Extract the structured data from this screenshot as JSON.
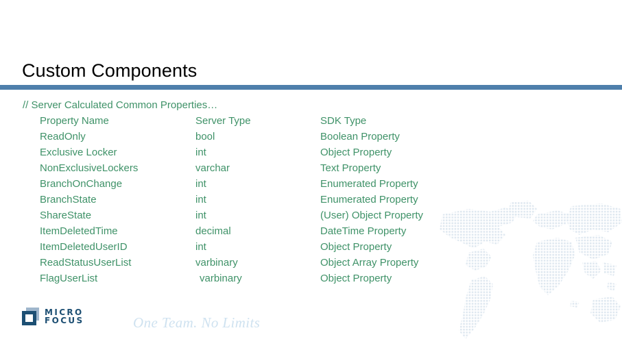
{
  "slide": {
    "title": "Custom Components",
    "accent_color": "#4e7fab",
    "body_text_color": "#3f9268",
    "title_color": "#000000"
  },
  "body": {
    "comment": "// Server Calculated Common Properties…",
    "columns": {
      "name": "Property Name",
      "server_type": "Server Type",
      "sdk_type": "SDK Type"
    },
    "rows": [
      {
        "name": "Property Name",
        "server_type": "Server Type",
        "sdk_type": "SDK Type",
        "indent_server": false
      },
      {
        "name": "ReadOnly",
        "server_type": "bool",
        "sdk_type": "Boolean Property",
        "indent_server": false
      },
      {
        "name": "Exclusive Locker",
        "server_type": "int",
        "sdk_type": "Object Property",
        "indent_server": false
      },
      {
        "name": "NonExclusiveLockers",
        "server_type": "varchar",
        "sdk_type": "Text Property",
        "indent_server": false
      },
      {
        "name": "BranchOnChange",
        "server_type": "int",
        "sdk_type": "Enumerated Property",
        "indent_server": false
      },
      {
        "name": "BranchState",
        "server_type": "int",
        "sdk_type": "Enumerated Property",
        "indent_server": false
      },
      {
        "name": "ShareState",
        "server_type": "int",
        "sdk_type": "(User) Object Property",
        "indent_server": false
      },
      {
        "name": "ItemDeletedTime",
        "server_type": "decimal",
        "sdk_type": "DateTime Property",
        "indent_server": false
      },
      {
        "name": "ItemDeletedUserID",
        "server_type": "int",
        "sdk_type": "Object Property",
        "indent_server": false
      },
      {
        "name": "ReadStatusUserList",
        "server_type": "varbinary",
        "sdk_type": "Object Array Property",
        "indent_server": false
      },
      {
        "name": "FlagUserList",
        "server_type": "varbinary",
        "sdk_type": "Object Property",
        "indent_server": true
      }
    ]
  },
  "footer": {
    "logo_line1": "MICRO",
    "logo_line2": "FOCUS",
    "logo_color": "#1d4f73",
    "tagline": "One Team. No Limits",
    "tagline_color": "#cfe2f0"
  }
}
